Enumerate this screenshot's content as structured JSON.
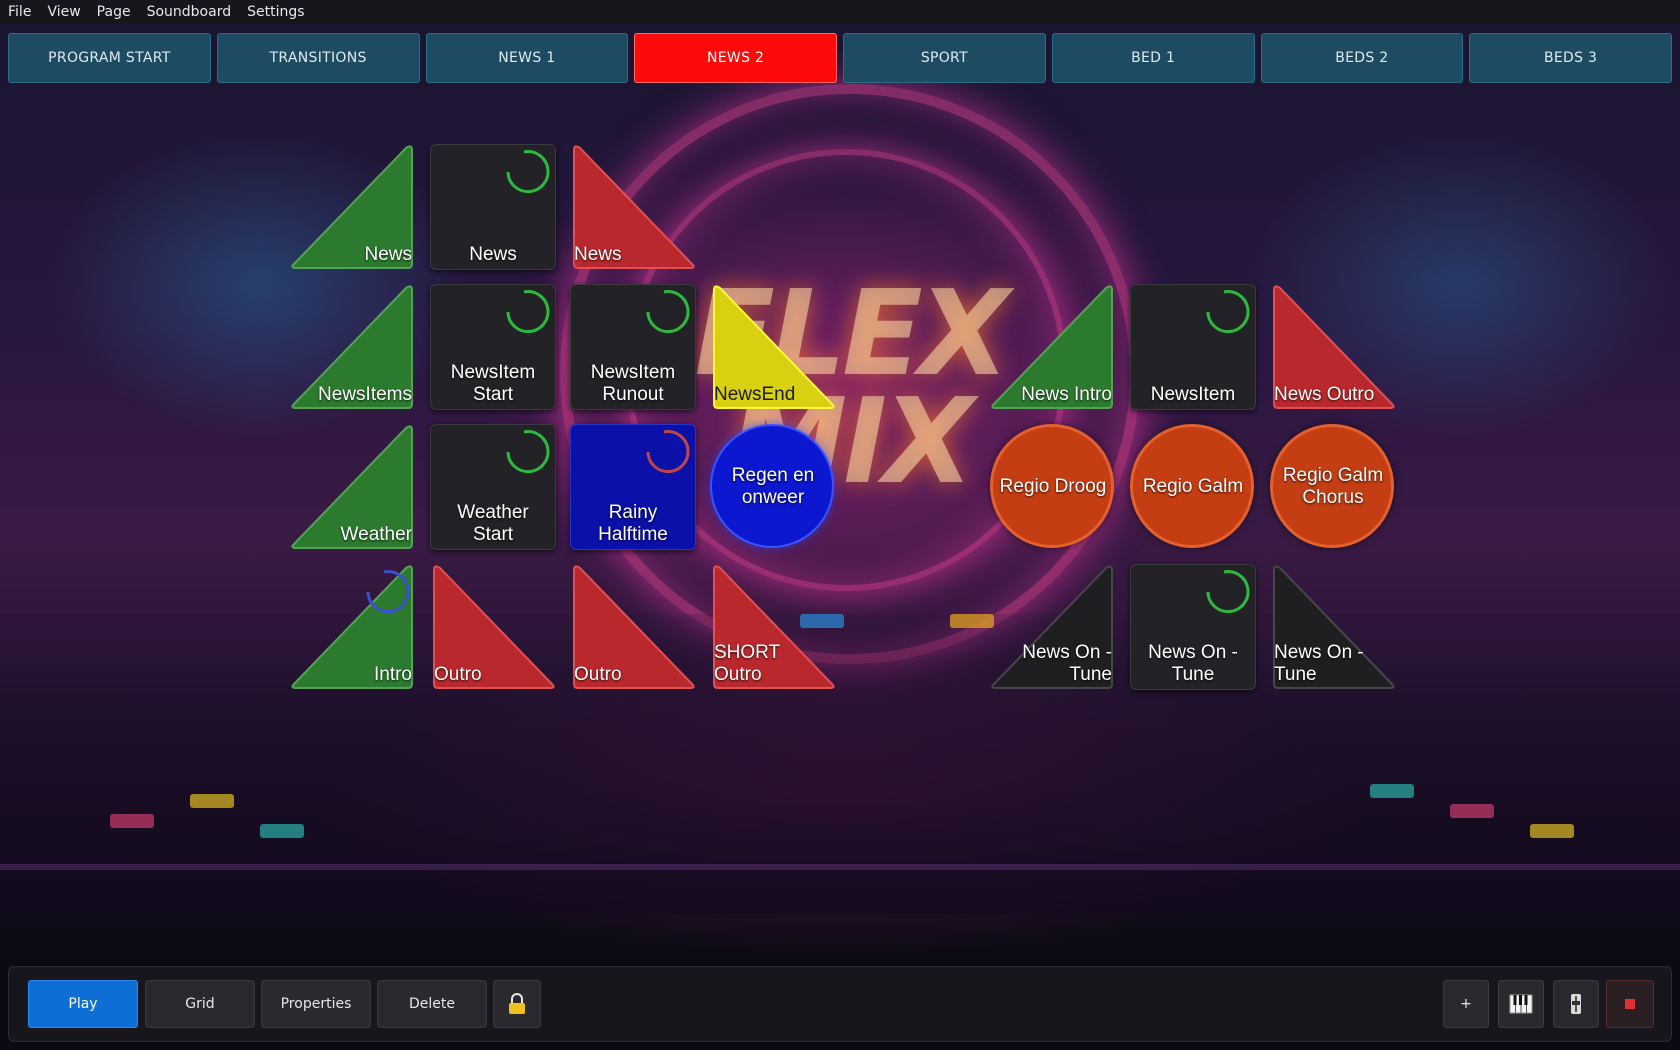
{
  "menu": [
    "File",
    "View",
    "Page",
    "Soundboard",
    "Settings"
  ],
  "tabs": [
    {
      "label": "PROGRAM START",
      "active": false
    },
    {
      "label": "TRANSITIONS",
      "active": false
    },
    {
      "label": "NEWS 1",
      "active": false
    },
    {
      "label": "NEWS 2",
      "active": true
    },
    {
      "label": "SPORT",
      "active": false
    },
    {
      "label": "BED 1",
      "active": false
    },
    {
      "label": "BEDS 2",
      "active": false
    },
    {
      "label": "BEDS 3",
      "active": false
    }
  ],
  "background": {
    "logo_lines": [
      "FLEX",
      "MIX"
    ]
  },
  "pads": [
    {
      "label": "News",
      "shape": "triangle",
      "color": "#2c7a2e"
    },
    {
      "label": "News",
      "shape": "square",
      "color": "#232327"
    },
    {
      "label": "News",
      "shape": "triangle",
      "color": "#b8282c"
    },
    {
      "label": "NewsItems",
      "shape": "triangle",
      "color": "#2c7a2e"
    },
    {
      "label": "NewsItem Start",
      "shape": "square",
      "color": "#232327"
    },
    {
      "label": "NewsItem Runout",
      "shape": "square",
      "color": "#232327"
    },
    {
      "label": "NewsEnd",
      "shape": "triangle",
      "color": "#d8d010"
    },
    {
      "label": "News Intro",
      "shape": "triangle",
      "color": "#2c7a2e"
    },
    {
      "label": "NewsItem",
      "shape": "square",
      "color": "#232327"
    },
    {
      "label": "News Outro",
      "shape": "triangle",
      "color": "#b8282c"
    },
    {
      "label": "Weather",
      "shape": "triangle",
      "color": "#2c7a2e"
    },
    {
      "label": "Weather Start",
      "shape": "square",
      "color": "#232327"
    },
    {
      "label": "Rainy Halftime",
      "shape": "square",
      "color": "#0a10a8"
    },
    {
      "label": "Regen en onweer",
      "shape": "circle",
      "color": "#0b18d0"
    },
    {
      "label": "Regio Droog",
      "shape": "circle",
      "color": "#c53d12"
    },
    {
      "label": "Regio Galm",
      "shape": "circle",
      "color": "#c53d12"
    },
    {
      "label": "Regio Galm Chorus",
      "shape": "circle",
      "color": "#c53d12"
    },
    {
      "label": "Intro",
      "shape": "triangle",
      "color": "#2c7a2e"
    },
    {
      "label": "Outro",
      "shape": "triangle",
      "color": "#b8282c"
    },
    {
      "label": "Outro",
      "shape": "triangle",
      "color": "#b8282c"
    },
    {
      "label": "SHORT Outro",
      "shape": "triangle",
      "color": "#b8282c"
    },
    {
      "label": "News On - Tune",
      "shape": "triangle",
      "color": "#1f1f22"
    },
    {
      "label": "News On - Tune",
      "shape": "square",
      "color": "#232327"
    },
    {
      "label": "News On - Tune",
      "shape": "triangle",
      "color": "#1f1f22"
    }
  ],
  "toolbar": {
    "play": "Play",
    "grid": "Grid",
    "properties": "Properties",
    "delete": "Delete",
    "lock_icon": "padlock-icon",
    "add": "+",
    "piano_icon": "piano-keys-icon",
    "fader_icon": "fader-icon",
    "stop_icon": "stop-icon",
    "play_color": "#0d6fd6",
    "active_tab_color": "#ff0a0a"
  }
}
